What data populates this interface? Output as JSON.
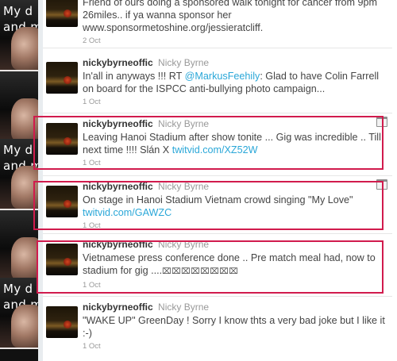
{
  "background": {
    "wall_text": [
      "My d",
      "and m"
    ]
  },
  "tweets": [
    {
      "handle": "",
      "name": "",
      "text_parts": [
        {
          "t": "Friend of ours doing a sponsored walk tonight for cancer from 9pm 26miles.. if ya wanna sponsor her www.sponsormetoshine.org/jessieratcliff.",
          "link": false
        }
      ],
      "time": "2 Oct"
    },
    {
      "handle": "nickybyrneoffic",
      "name": "Nicky Byrne",
      "text_parts": [
        {
          "t": "In'all in anyways !!! RT ",
          "link": false
        },
        {
          "t": "@MarkusFeehily",
          "link": true
        },
        {
          "t": ": Glad to have Colin Farrell on board for the ISPCC anti-bullying photo campaign...",
          "link": false
        }
      ],
      "time": "1 Oct"
    },
    {
      "handle": "nickybyrneoffic",
      "name": "Nicky Byrne",
      "text_parts": [
        {
          "t": "Leaving Hanoi Stadium after show tonite ... Gig was incredible .. Till next time !!!! Slán X ",
          "link": false
        },
        {
          "t": "twitvid.com/XZ52W",
          "link": true
        }
      ],
      "time": "1 Oct"
    },
    {
      "handle": "nickybyrneoffic",
      "name": "Nicky Byrne",
      "text_parts": [
        {
          "t": "On stage in Hanoi Stadium Vietnam crowd singing \"My Love\" ",
          "link": false
        },
        {
          "t": "twitvid.com/GAWZC",
          "link": true
        }
      ],
      "time": "1 Oct"
    },
    {
      "handle": "nickybyrneoffic",
      "name": "Nicky Byrne",
      "text_parts": [
        {
          "t": "Vietnamese press conference done .. Pre match meal had, now to stadium for gig ....",
          "link": false
        },
        {
          "t": "⌧⌧⌧⌧⌧⌧⌧⌧",
          "link": false
        }
      ],
      "time": "1 Oct"
    },
    {
      "handle": "nickybyrneoffic",
      "name": "Nicky Byrne",
      "text_parts": [
        {
          "t": "\"WAKE UP\" GreenDay ! Sorry I know thts a very bad joke but I like it :-)",
          "link": false
        }
      ],
      "time": "1 Oct"
    }
  ]
}
